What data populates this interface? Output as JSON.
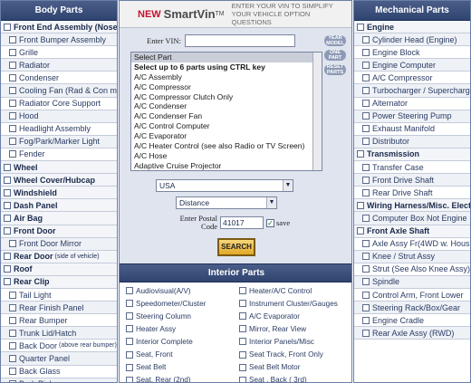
{
  "body_parts": {
    "title": "Body Parts",
    "rows": [
      {
        "label": "Front End Assembly (Nose)",
        "type": "cat"
      },
      {
        "label": "Front Bumper Assembly",
        "type": "sub"
      },
      {
        "label": "Grille",
        "type": "sub"
      },
      {
        "label": "Radiator",
        "type": "sub"
      },
      {
        "label": "Condenser",
        "type": "sub"
      },
      {
        "label": "Cooling Fan (Rad & Con mtd)",
        "type": "sub"
      },
      {
        "label": "Radiator Core Support",
        "type": "sub"
      },
      {
        "label": "Hood",
        "type": "sub"
      },
      {
        "label": "Headlight Assembly",
        "type": "sub"
      },
      {
        "label": "Fog/Park/Marker Light",
        "type": "sub"
      },
      {
        "label": "Fender",
        "type": "sub"
      },
      {
        "label": "Wheel",
        "type": "cat"
      },
      {
        "label": "Wheel Cover/Hubcap",
        "type": "cat"
      },
      {
        "label": "Windshield",
        "type": "cat"
      },
      {
        "label": "Dash Panel",
        "type": "cat"
      },
      {
        "label": "Air Bag",
        "type": "cat"
      },
      {
        "label": "Front Door",
        "type": "cat"
      },
      {
        "label": "Front Door Mirror",
        "type": "sub"
      },
      {
        "label": "Rear Door",
        "note": "(side of vehicle)",
        "type": "cat"
      },
      {
        "label": "Roof",
        "type": "cat"
      },
      {
        "label": "Rear Clip",
        "type": "cat"
      },
      {
        "label": "Tail Light",
        "type": "sub"
      },
      {
        "label": "Rear Finish Panel",
        "type": "sub"
      },
      {
        "label": "Rear Bumper",
        "type": "sub"
      },
      {
        "label": "Trunk Lid/Hatch",
        "type": "sub"
      },
      {
        "label": "Back Door",
        "note": "(above rear bumper)",
        "type": "sub"
      },
      {
        "label": "Quarter Panel",
        "type": "sub"
      },
      {
        "label": "Back Glass",
        "type": "sub"
      },
      {
        "label": "Bed, Pickup",
        "type": "sub"
      }
    ]
  },
  "banner": {
    "new": "NEW",
    "brand": "SmartVin",
    "tm": "TM",
    "tagline_1": "Enter your VIN to simplify",
    "tagline_2": "your vehicle option questions"
  },
  "vin": {
    "label": "Enter VIN:",
    "value": ""
  },
  "side_buttons": [
    "YEAR MODEL",
    "ONE PART",
    "RESET PARTS"
  ],
  "parts_select": {
    "options": [
      {
        "label": "Select Part",
        "selected": true
      },
      {
        "label": "Select up to 6 parts using CTRL key",
        "bold": true
      },
      {
        "label": "A/C Assembly"
      },
      {
        "label": "A/C Compressor"
      },
      {
        "label": "A/C Compressor Clutch Only"
      },
      {
        "label": "A/C Condenser"
      },
      {
        "label": "A/C Condenser Fan"
      },
      {
        "label": "A/C Control Computer"
      },
      {
        "label": "A/C Evaporator"
      },
      {
        "label": "A/C Heater Control (see also Radio or TV Screen)"
      },
      {
        "label": "A/C Hose"
      },
      {
        "label": "Adaptive Cruise Projector"
      }
    ]
  },
  "country_select": {
    "value": "USA"
  },
  "sort_select": {
    "value": "Distance"
  },
  "postal": {
    "label_1": "Enter Postal",
    "label_2": "Code",
    "value": "41017",
    "save_label": "save",
    "save_checked": true
  },
  "search_button": "SEARCH",
  "interior_parts": {
    "title": "Interior Parts",
    "items": [
      "Audiovisual(A/V)",
      "Heater/A/C Control",
      "Speedometer/Cluster",
      "Instrument Cluster/Gauges",
      "Steering Column",
      "A/C Evaporator",
      "Heater Assy",
      "Mirror, Rear View",
      "Interior Complete",
      "Interior Panels/Misc",
      "Seat, Front",
      "Seat Track, Front Only",
      "Seat Belt",
      "Seat Belt Motor",
      "Seat, Rear (2nd)",
      "Seat , Back ( 3rd)"
    ]
  },
  "mechanical_parts": {
    "title": "Mechanical Parts",
    "rows": [
      {
        "label": "Engine",
        "type": "cat"
      },
      {
        "label": "Cylinder Head (Engine)",
        "type": "sub"
      },
      {
        "label": "Engine Block",
        "type": "sub"
      },
      {
        "label": "Engine Computer",
        "type": "sub"
      },
      {
        "label": "A/C Compressor",
        "type": "sub"
      },
      {
        "label": "Turbocharger / Supercharger",
        "type": "sub"
      },
      {
        "label": "Alternator",
        "type": "sub"
      },
      {
        "label": "Power Steering Pump",
        "type": "sub"
      },
      {
        "label": "Exhaust Manifold",
        "type": "sub"
      },
      {
        "label": "Distributor",
        "type": "sub"
      },
      {
        "label": "Transmission",
        "type": "cat"
      },
      {
        "label": "Transfer Case",
        "type": "sub"
      },
      {
        "label": "Front Drive Shaft",
        "type": "sub"
      },
      {
        "label": "Rear Drive Shaft",
        "type": "sub"
      },
      {
        "label": "Wiring Harness/Misc. Electric",
        "type": "cat"
      },
      {
        "label": "Computer Box Not Engine",
        "type": "sub"
      },
      {
        "label": "Front Axle Shaft",
        "type": "cat"
      },
      {
        "label": "Axle Assy Fr(4WD w. Housing)",
        "type": "sub"
      },
      {
        "label": "Knee / Strut Assy",
        "type": "sub"
      },
      {
        "label": "Strut (See Also Knee Assy)",
        "type": "sub"
      },
      {
        "label": "Spindle",
        "type": "sub"
      },
      {
        "label": "Control Arm, Front Lower",
        "type": "sub"
      },
      {
        "label": "Steering Rack/Box/Gear",
        "type": "sub"
      },
      {
        "label": "Engine Cradle",
        "type": "sub"
      },
      {
        "label": "Rear Axle Assy (RWD)",
        "type": "sub"
      }
    ]
  },
  "colors": {
    "header_bg": "#2f4470",
    "accent_new": "#c8102e",
    "search_btn": "#e2a82a"
  }
}
